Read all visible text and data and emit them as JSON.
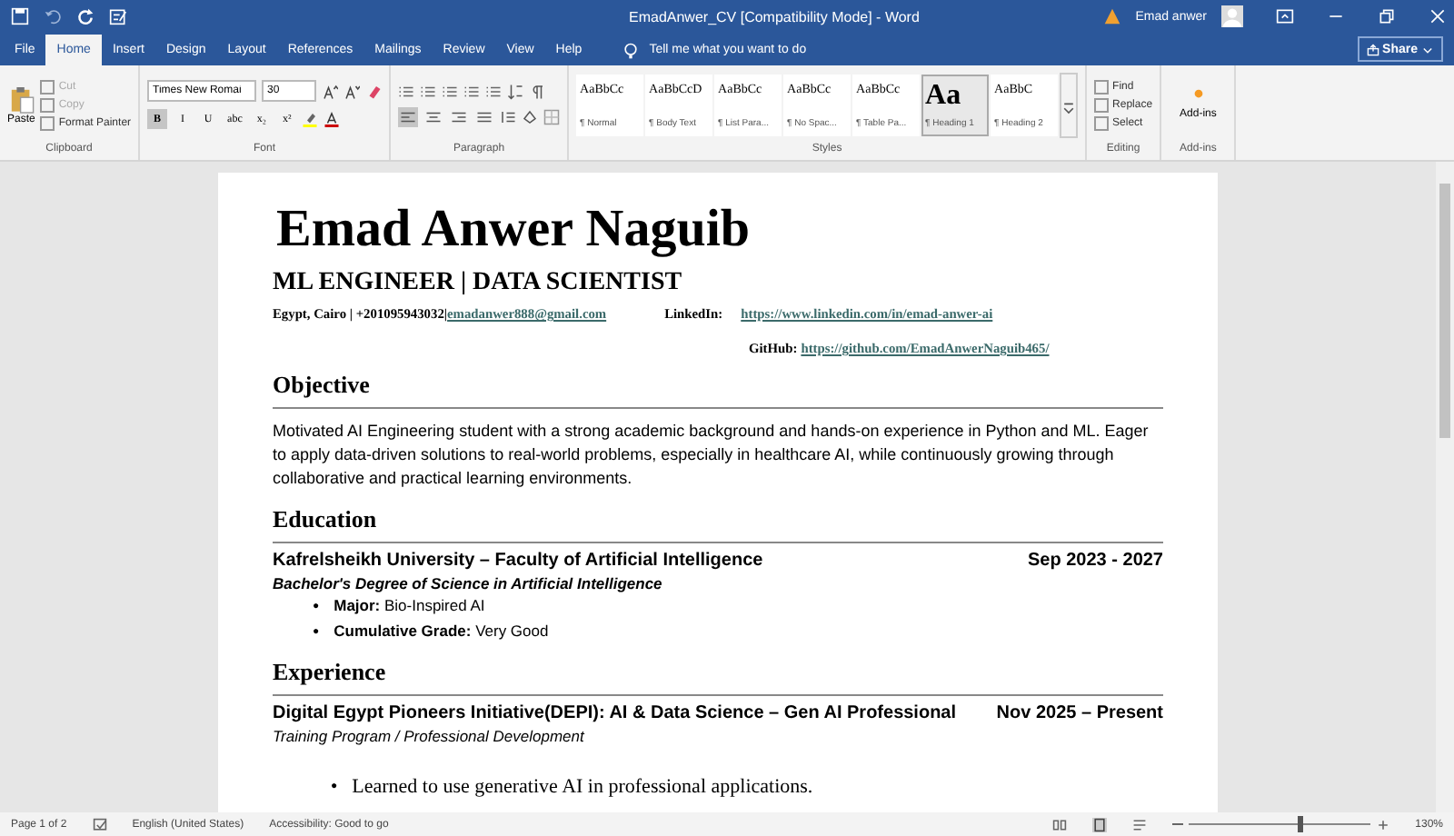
{
  "window": {
    "title": "EmadAnwer_CV [Compatibility Mode]  -  Word",
    "user": "Emad anwer"
  },
  "tabs": [
    {
      "label": "File",
      "selected": false
    },
    {
      "label": "Home",
      "selected": true
    },
    {
      "label": "Insert",
      "selected": false
    },
    {
      "label": "Design",
      "selected": false
    },
    {
      "label": "Layout",
      "selected": false
    },
    {
      "label": "References",
      "selected": false
    },
    {
      "label": "Mailings",
      "selected": false
    },
    {
      "label": "Review",
      "selected": false
    },
    {
      "label": "View",
      "selected": false
    },
    {
      "label": "Help",
      "selected": false
    }
  ],
  "tell_me": {
    "placeholder": "Tell me what you want to do"
  },
  "share": "Share",
  "ribbon": {
    "clipboard": {
      "label": "Clipboard",
      "paste": "Paste",
      "items": [
        {
          "label": "Cut",
          "disabled": true
        },
        {
          "label": "Copy",
          "disabled": true
        },
        {
          "label": "Format Painter",
          "disabled": false
        }
      ]
    },
    "font": {
      "label": "Font",
      "name": "Times New Romai",
      "size": "30",
      "formats": [
        {
          "label": "B",
          "selected": true
        },
        {
          "label": "I",
          "selected": false
        },
        {
          "label": "U",
          "selected": false
        },
        {
          "label": "abc",
          "selected": false
        },
        {
          "label": "x₂",
          "selected": false
        },
        {
          "label": "x²",
          "selected": false
        }
      ]
    },
    "paragraph": {
      "label": "Paragraph",
      "alignments": [
        {
          "selected": true
        },
        {
          "selected": false
        },
        {
          "selected": false
        },
        {
          "selected": false
        }
      ]
    },
    "styles": {
      "label": "Styles",
      "items": [
        {
          "preview": "AaBbCc",
          "name": "¶ Normal",
          "selected": false
        },
        {
          "preview": "AaBbCcD",
          "name": "¶ Body Text",
          "selected": false
        },
        {
          "preview": "AaBbCc",
          "name": "¶ List Para...",
          "selected": false
        },
        {
          "preview": "AaBbCc",
          "name": "¶ No Spac...",
          "selected": false
        },
        {
          "preview": "AaBbCc",
          "name": "¶ Table Pa...",
          "selected": false
        },
        {
          "preview": "Aa",
          "name": "¶ Heading 1",
          "selected": true
        },
        {
          "preview": "AaBbC",
          "name": "¶ Heading 2",
          "selected": false
        }
      ]
    },
    "editing": {
      "label": "Editing",
      "items": [
        "Find",
        "Replace",
        "Select"
      ]
    },
    "addins": {
      "label": "Add-ins",
      "button": "Add-ins"
    }
  },
  "document": {
    "name": "Emad Anwer Naguib",
    "subtitle": "ML ENGINEER | DATA SCIENTIST",
    "contact": "Egypt, Cairo | +201095943032| ",
    "email": "emadanwer888@gmail.com",
    "linkedin_label": "LinkedIn:",
    "linkedin": "https://www.linkedin.com/in/emad-anwer-ai",
    "github_label": "GitHub:",
    "github": "https://github.com/EmadAnwerNaguib465/",
    "sections": [
      {
        "heading": "Objective",
        "paragraph": "Motivated AI Engineering student with a strong academic background and hands-on experience in Python and ML. Eager to apply data-driven solutions to real-world problems, especially in healthcare AI, while continuously growing through collaborative and practical learning environments."
      },
      {
        "heading": "Education",
        "entries": [
          {
            "title": "Kafrelsheikh University – Faculty of Artificial Intelligence",
            "date": "Sep 2023 - 2027",
            "subtitle": "Bachelor's Degree of Science in Artificial Intelligence",
            "subtitle_bold": true,
            "bullets": [
              {
                "marker": "●",
                "text": "**Major:** Bio-Inspired AI",
                "kind": "sans"
              },
              {
                "marker": "●",
                "text": "**Cumulative Grade:** Very Good",
                "kind": "sans"
              }
            ]
          }
        ]
      },
      {
        "heading": "Experience",
        "entries": [
          {
            "title": "Digital Egypt Pioneers Initiative(DEPI): AI & Data Science – Gen AI Professional",
            "date": "Nov 2025 – Present",
            "subtitle": "Training Program / Professional Development",
            "subtitle_bold": false,
            "bullets": [
              {
                "marker": "●",
                "text": "Learned to use generative AI in professional applications.",
                "kind": "serif"
              }
            ]
          }
        ]
      }
    ]
  },
  "status_bar": {
    "page": "Page 1 of 2",
    "language": "English (United States)",
    "accessibility": "Accessibility: Good to go",
    "zoom": "130%",
    "zoom_slider": {
      "level": 0.6
    }
  }
}
